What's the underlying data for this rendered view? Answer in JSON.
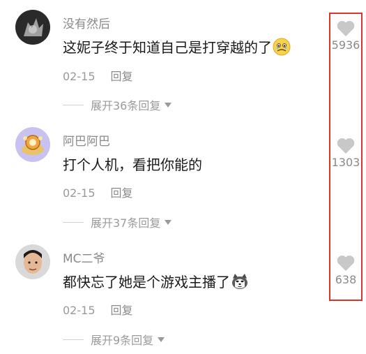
{
  "comments": [
    {
      "username": "没有然后",
      "content": "这妮子终于知道自己是打穿越的了",
      "emoji": "crying-face-emoji",
      "date": "02-15",
      "reply_label": "回复",
      "expand_label": "展开36条回复",
      "likes": "5936"
    },
    {
      "username": "阿巴阿巴",
      "content": "打个人机，看把你能的",
      "emoji": "",
      "date": "02-15",
      "reply_label": "回复",
      "expand_label": "展开37条回复",
      "likes": "1303"
    },
    {
      "username": "MC二爷",
      "content": "都快忘了她是个游戏主播了",
      "emoji": "husky-dog-emoji",
      "date": "02-15",
      "reply_label": "回复",
      "expand_label": "展开9条回复",
      "likes": "638"
    }
  ],
  "colors": {
    "highlight_border": "#d9342b",
    "heart": "#c8c8c8",
    "muted_text": "#9a9a9a"
  }
}
